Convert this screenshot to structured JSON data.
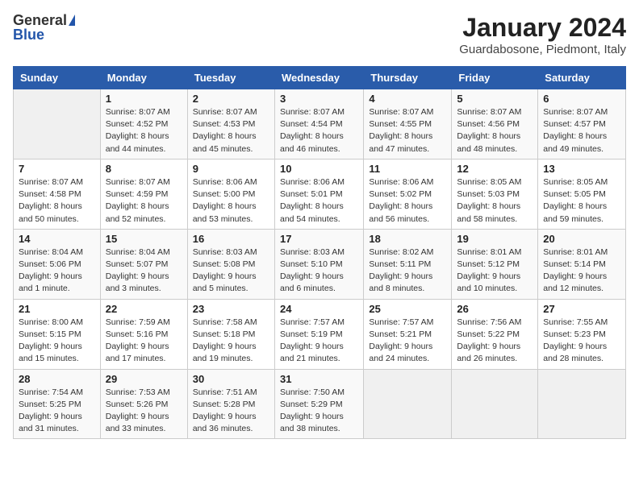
{
  "header": {
    "logo_general": "General",
    "logo_blue": "Blue",
    "title": "January 2024",
    "location": "Guardabosone, Piedmont, Italy"
  },
  "columns": [
    "Sunday",
    "Monday",
    "Tuesday",
    "Wednesday",
    "Thursday",
    "Friday",
    "Saturday"
  ],
  "weeks": [
    [
      {
        "day": "",
        "info": ""
      },
      {
        "day": "1",
        "info": "Sunrise: 8:07 AM\nSunset: 4:52 PM\nDaylight: 8 hours\nand 44 minutes."
      },
      {
        "day": "2",
        "info": "Sunrise: 8:07 AM\nSunset: 4:53 PM\nDaylight: 8 hours\nand 45 minutes."
      },
      {
        "day": "3",
        "info": "Sunrise: 8:07 AM\nSunset: 4:54 PM\nDaylight: 8 hours\nand 46 minutes."
      },
      {
        "day": "4",
        "info": "Sunrise: 8:07 AM\nSunset: 4:55 PM\nDaylight: 8 hours\nand 47 minutes."
      },
      {
        "day": "5",
        "info": "Sunrise: 8:07 AM\nSunset: 4:56 PM\nDaylight: 8 hours\nand 48 minutes."
      },
      {
        "day": "6",
        "info": "Sunrise: 8:07 AM\nSunset: 4:57 PM\nDaylight: 8 hours\nand 49 minutes."
      }
    ],
    [
      {
        "day": "7",
        "info": "Sunrise: 8:07 AM\nSunset: 4:58 PM\nDaylight: 8 hours\nand 50 minutes."
      },
      {
        "day": "8",
        "info": "Sunrise: 8:07 AM\nSunset: 4:59 PM\nDaylight: 8 hours\nand 52 minutes."
      },
      {
        "day": "9",
        "info": "Sunrise: 8:06 AM\nSunset: 5:00 PM\nDaylight: 8 hours\nand 53 minutes."
      },
      {
        "day": "10",
        "info": "Sunrise: 8:06 AM\nSunset: 5:01 PM\nDaylight: 8 hours\nand 54 minutes."
      },
      {
        "day": "11",
        "info": "Sunrise: 8:06 AM\nSunset: 5:02 PM\nDaylight: 8 hours\nand 56 minutes."
      },
      {
        "day": "12",
        "info": "Sunrise: 8:05 AM\nSunset: 5:03 PM\nDaylight: 8 hours\nand 58 minutes."
      },
      {
        "day": "13",
        "info": "Sunrise: 8:05 AM\nSunset: 5:05 PM\nDaylight: 8 hours\nand 59 minutes."
      }
    ],
    [
      {
        "day": "14",
        "info": "Sunrise: 8:04 AM\nSunset: 5:06 PM\nDaylight: 9 hours\nand 1 minute."
      },
      {
        "day": "15",
        "info": "Sunrise: 8:04 AM\nSunset: 5:07 PM\nDaylight: 9 hours\nand 3 minutes."
      },
      {
        "day": "16",
        "info": "Sunrise: 8:03 AM\nSunset: 5:08 PM\nDaylight: 9 hours\nand 5 minutes."
      },
      {
        "day": "17",
        "info": "Sunrise: 8:03 AM\nSunset: 5:10 PM\nDaylight: 9 hours\nand 6 minutes."
      },
      {
        "day": "18",
        "info": "Sunrise: 8:02 AM\nSunset: 5:11 PM\nDaylight: 9 hours\nand 8 minutes."
      },
      {
        "day": "19",
        "info": "Sunrise: 8:01 AM\nSunset: 5:12 PM\nDaylight: 9 hours\nand 10 minutes."
      },
      {
        "day": "20",
        "info": "Sunrise: 8:01 AM\nSunset: 5:14 PM\nDaylight: 9 hours\nand 12 minutes."
      }
    ],
    [
      {
        "day": "21",
        "info": "Sunrise: 8:00 AM\nSunset: 5:15 PM\nDaylight: 9 hours\nand 15 minutes."
      },
      {
        "day": "22",
        "info": "Sunrise: 7:59 AM\nSunset: 5:16 PM\nDaylight: 9 hours\nand 17 minutes."
      },
      {
        "day": "23",
        "info": "Sunrise: 7:58 AM\nSunset: 5:18 PM\nDaylight: 9 hours\nand 19 minutes."
      },
      {
        "day": "24",
        "info": "Sunrise: 7:57 AM\nSunset: 5:19 PM\nDaylight: 9 hours\nand 21 minutes."
      },
      {
        "day": "25",
        "info": "Sunrise: 7:57 AM\nSunset: 5:21 PM\nDaylight: 9 hours\nand 24 minutes."
      },
      {
        "day": "26",
        "info": "Sunrise: 7:56 AM\nSunset: 5:22 PM\nDaylight: 9 hours\nand 26 minutes."
      },
      {
        "day": "27",
        "info": "Sunrise: 7:55 AM\nSunset: 5:23 PM\nDaylight: 9 hours\nand 28 minutes."
      }
    ],
    [
      {
        "day": "28",
        "info": "Sunrise: 7:54 AM\nSunset: 5:25 PM\nDaylight: 9 hours\nand 31 minutes."
      },
      {
        "day": "29",
        "info": "Sunrise: 7:53 AM\nSunset: 5:26 PM\nDaylight: 9 hours\nand 33 minutes."
      },
      {
        "day": "30",
        "info": "Sunrise: 7:51 AM\nSunset: 5:28 PM\nDaylight: 9 hours\nand 36 minutes."
      },
      {
        "day": "31",
        "info": "Sunrise: 7:50 AM\nSunset: 5:29 PM\nDaylight: 9 hours\nand 38 minutes."
      },
      {
        "day": "",
        "info": ""
      },
      {
        "day": "",
        "info": ""
      },
      {
        "day": "",
        "info": ""
      }
    ]
  ]
}
